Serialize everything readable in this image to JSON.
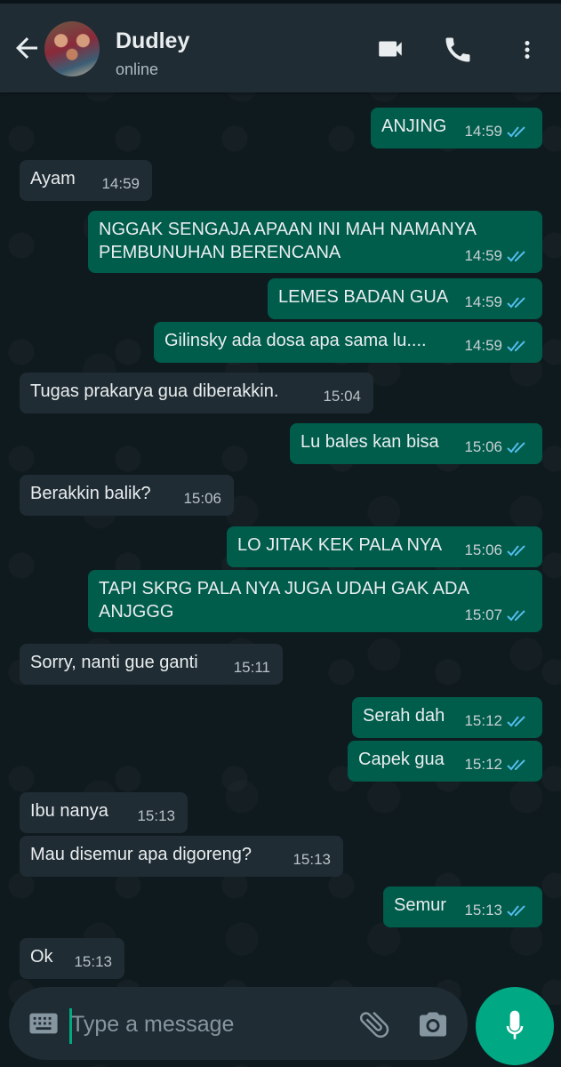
{
  "header": {
    "contact_name": "Dudley",
    "status": "online"
  },
  "colors": {
    "header_bg": "#1f2c33",
    "incoming_bubble": "#1f2c33",
    "outgoing_bubble": "#005c4b",
    "read_ticks": "#53bdeb",
    "accent": "#00a884"
  },
  "icons": {
    "back": "arrow-left-icon",
    "video": "video-call-icon",
    "call": "phone-icon",
    "menu": "more-vert-icon",
    "keyboard": "keyboard-icon",
    "attach": "paperclip-icon",
    "camera": "camera-icon",
    "mic": "mic-icon"
  },
  "messages": [
    {
      "dir": "out",
      "text": "ANJING",
      "time": "14:59",
      "status": "read"
    },
    {
      "dir": "in",
      "text": "Ayam",
      "time": "14:59"
    },
    {
      "dir": "out",
      "text": "NGGAK SENGAJA APAAN INI MAH NAMANYA PEMBUNUHAN BERENCANA",
      "time": "14:59",
      "status": "read"
    },
    {
      "dir": "out",
      "text": "LEMES BADAN GUA",
      "time": "14:59",
      "status": "read"
    },
    {
      "dir": "out",
      "text": "Gilinsky ada dosa apa sama lu....",
      "time": "14:59",
      "status": "read"
    },
    {
      "dir": "in",
      "text": "Tugas prakarya gua diberakkin.",
      "time": "15:04"
    },
    {
      "dir": "out",
      "text": "Lu bales kan bisa",
      "time": "15:06",
      "status": "read"
    },
    {
      "dir": "in",
      "text": "Berakkin balik?",
      "time": "15:06"
    },
    {
      "dir": "out",
      "text": "LO JITAK KEK PALA NYA",
      "time": "15:06",
      "status": "read"
    },
    {
      "dir": "out",
      "text": "TAPI SKRG PALA NYA JUGA UDAH GAK ADA ANJGGG",
      "time": "15:07",
      "status": "read"
    },
    {
      "dir": "in",
      "text": "Sorry, nanti gue ganti",
      "time": "15:11"
    },
    {
      "dir": "out",
      "text": "Serah dah",
      "time": "15:12",
      "status": "read"
    },
    {
      "dir": "out",
      "text": "Capek gua",
      "time": "15:12",
      "status": "read"
    },
    {
      "dir": "in",
      "text": "Ibu nanya",
      "time": "15:13"
    },
    {
      "dir": "in",
      "text": "Mau disemur apa digoreng?",
      "time": "15:13"
    },
    {
      "dir": "out",
      "text": "Semur",
      "time": "15:13",
      "status": "read"
    },
    {
      "dir": "in",
      "text": "Ok",
      "time": "15:13"
    }
  ],
  "composer": {
    "placeholder": "Type a message"
  }
}
